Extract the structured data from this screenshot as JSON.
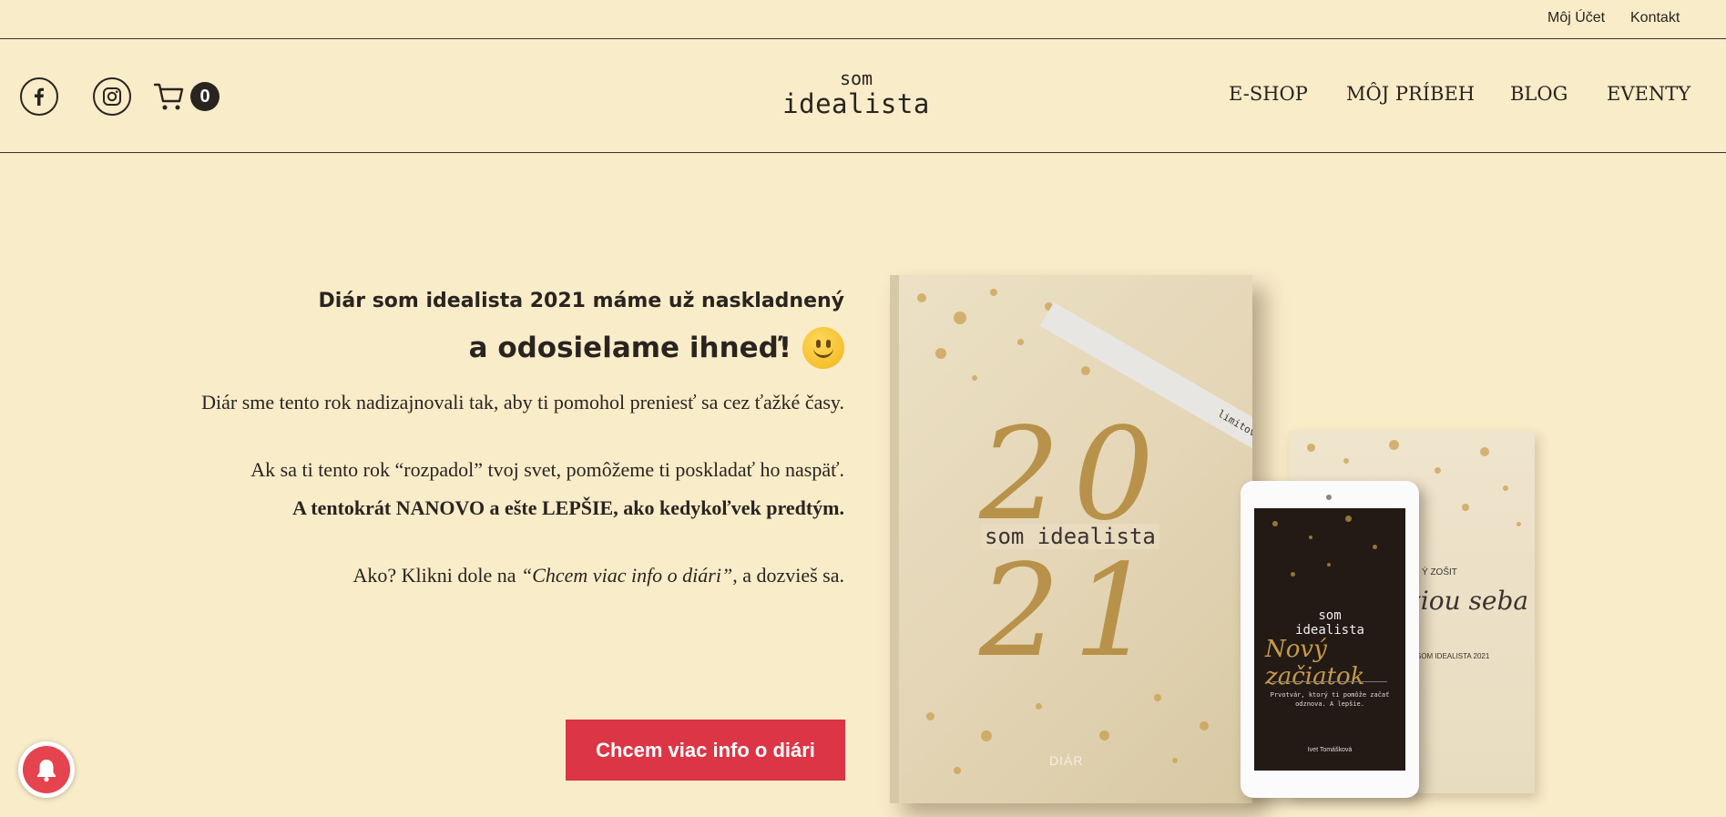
{
  "topbar": {
    "account": "Môj Účet",
    "contact": "Kontakt"
  },
  "header": {
    "logo_small": "som",
    "logo_big": "idealista",
    "cart_count": "0",
    "nav": [
      "E-SHOP",
      "MÔJ PRÍBEH",
      "BLOG",
      "EVENTY"
    ]
  },
  "hero": {
    "subtitle": "Diár som idealista 2021 máme už naskladnený",
    "title": "a odosielame ihneď!",
    "p1": "Diár sme tento rok nadizajnovali tak, aby ti pomohol preniesť sa cez ťažké časy.",
    "p2": "Ak sa ti tento rok “rozpadol” tvoj svet, pomôžeme ti poskladať ho naspäť.",
    "p3": "A tentokrát NANOVO a ešte LEPŠIE, ako kedykoľvek predtým.",
    "p4_pre": "Ako? Klikni dole na",
    "p4_em": "“Chcem viac info o diári”",
    "p4_post": ", a dozvieš sa.",
    "cta": "Chcem viac info o diári"
  },
  "products": {
    "book_ribbon": "limitovaná edícia",
    "book_year_top": "20",
    "book_year_bottom": "21",
    "book_brand": "som idealista",
    "book_label": "DIÁR",
    "tablet_brand_1": "som",
    "tablet_brand_2": "idealista",
    "tablet_script": "Nový začiatok",
    "tablet_note": "Prvotvár, ktorý ti pomôže začať odznova. A lepšie.",
    "tablet_author": "Ivet Tomášková",
    "notebook_label": "Ý ZOŠIT",
    "notebook_script": "ziou seba",
    "notebook_sub": "SOM IDEALISTA 2021"
  },
  "colors": {
    "background": "#f9ecc9",
    "accent": "#dc3545",
    "text": "#2a2420"
  }
}
